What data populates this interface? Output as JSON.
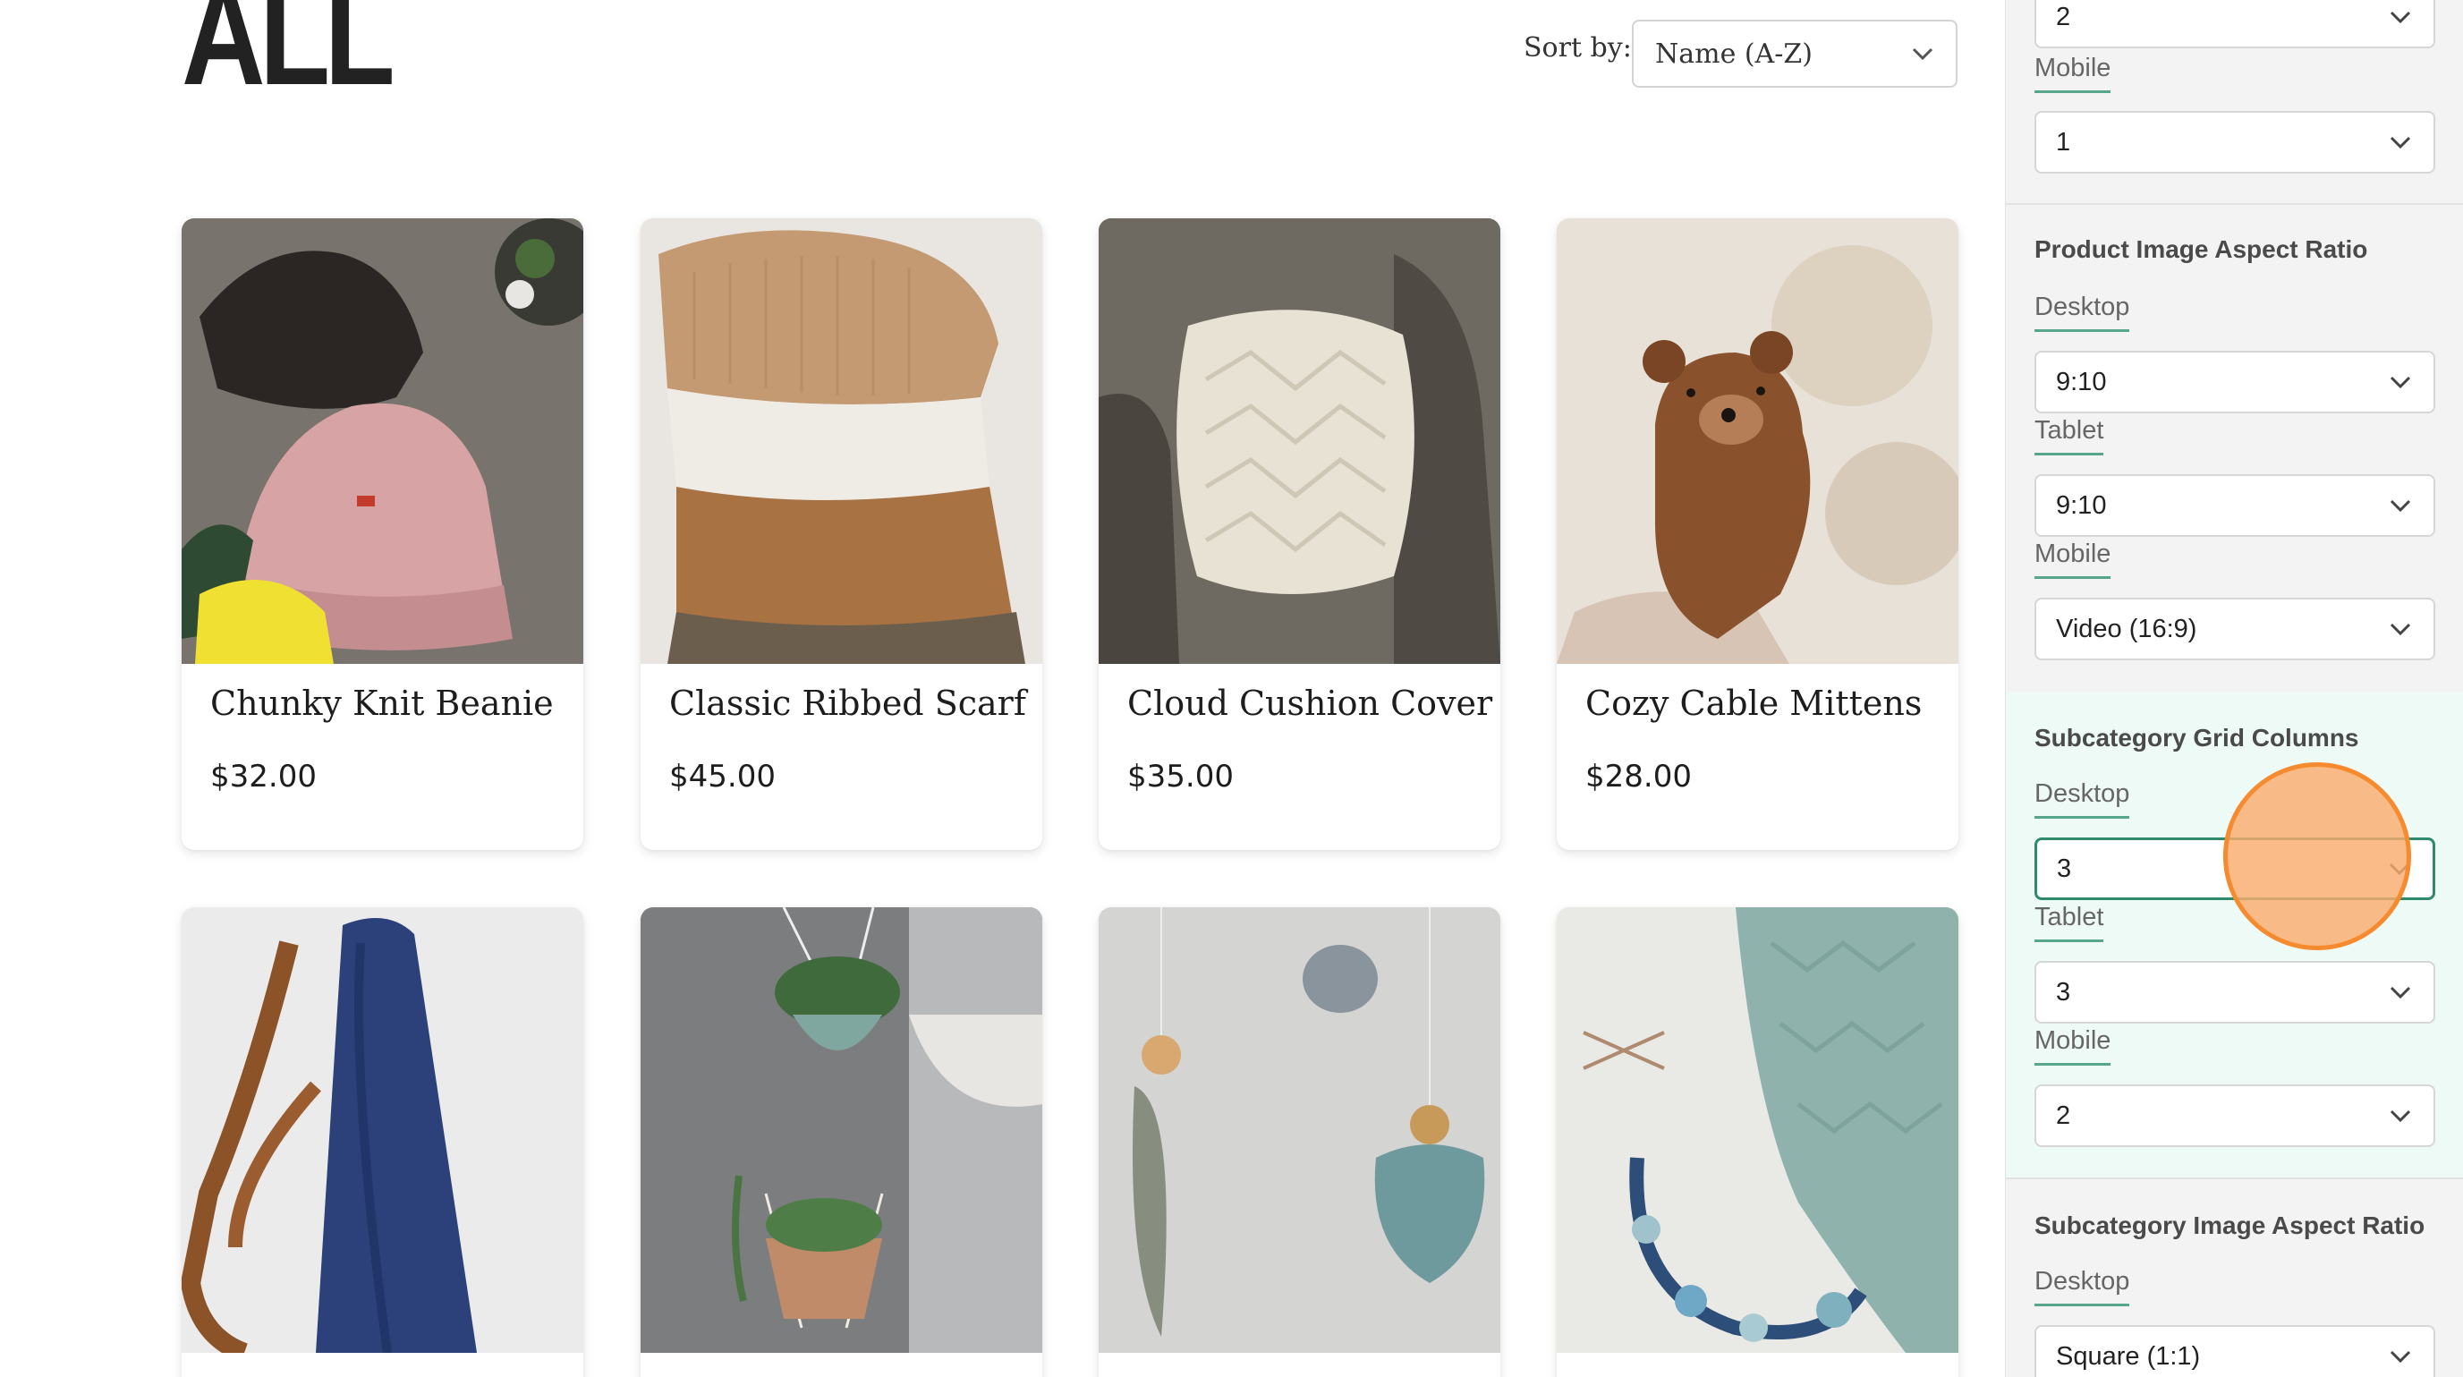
{
  "page": {
    "title": "ALL"
  },
  "sort": {
    "label": "Sort by:",
    "selected": "Name (A-Z)"
  },
  "products": [
    {
      "name": "Chunky Knit Beanie",
      "price": "$32.00",
      "image": "knit beanies"
    },
    {
      "name": "Classic Ribbed Scarf",
      "price": "$45.00",
      "image": "folded knit sweaters"
    },
    {
      "name": "Cloud Cushion Cover",
      "price": "$35.00",
      "image": "knit cushion on chair"
    },
    {
      "name": "Cozy Cable Mittens",
      "price": "$28.00",
      "image": "knit bear mitten"
    },
    {
      "name": "",
      "price": "",
      "image": "blue crochet bag"
    },
    {
      "name": "",
      "price": "",
      "image": "macrame plant hangers"
    },
    {
      "name": "",
      "price": "",
      "image": "crochet baby mobile"
    },
    {
      "name": "",
      "price": "",
      "image": "knit blanket with floral wreath"
    }
  ],
  "panel": {
    "top_select_value": "2",
    "mobile_label": "Mobile",
    "top_mobile_value": "1",
    "product_aspect": {
      "title": "Product Image Aspect Ratio",
      "desktop_label": "Desktop",
      "desktop_value": "9:10",
      "tablet_label": "Tablet",
      "tablet_value": "9:10",
      "mobile_label": "Mobile",
      "mobile_value": "Video (16:9)"
    },
    "subcategory_grid": {
      "title": "Subcategory Grid Columns",
      "desktop_label": "Desktop",
      "desktop_value": "3",
      "tablet_label": "Tablet",
      "tablet_value": "3",
      "mobile_label": "Mobile",
      "mobile_value": "2"
    },
    "subcategory_aspect": {
      "title": "Subcategory Image Aspect Ratio",
      "desktop_label": "Desktop",
      "desktop_value": "Square (1:1)"
    }
  },
  "colors": {
    "accent": "#2d8a6b",
    "accent_underline": "#56a68a",
    "highlight_bg": "#eefaf5",
    "cursor": "#f58a2e"
  }
}
